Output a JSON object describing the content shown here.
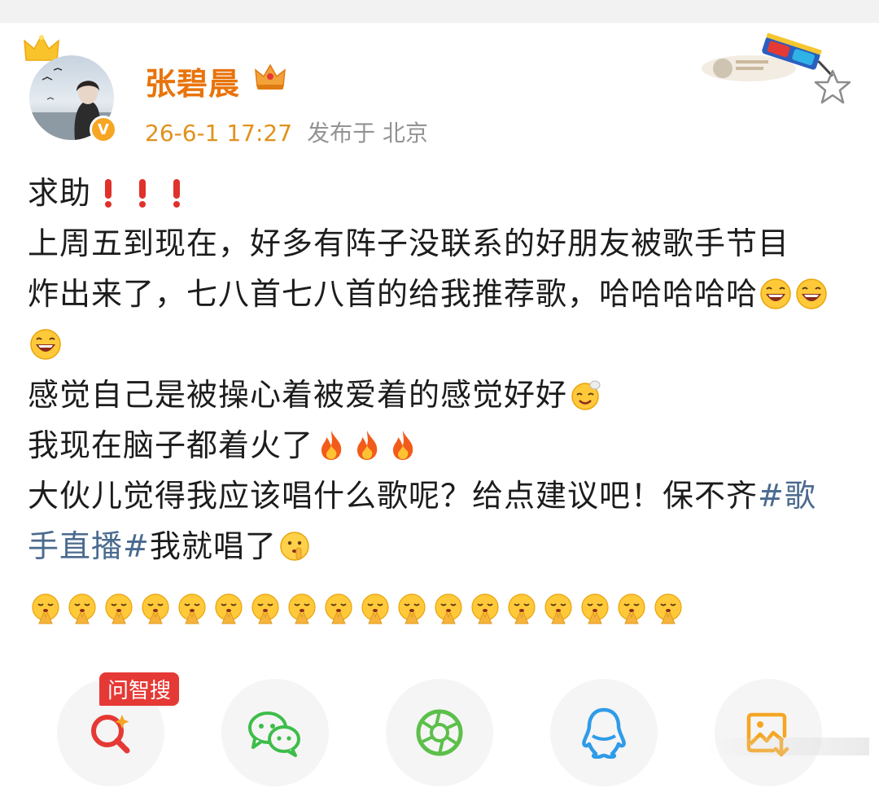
{
  "post": {
    "author": "张碧晨",
    "timestamp": "26-6-1 17:27",
    "location": "发布于 北京",
    "lines": {
      "l1": "求助",
      "l2": "上周五到现在，好多有阵子没联系的好朋友被歌手节目",
      "l3": "炸出来了，七八首七八首的给我推荐歌，哈哈哈哈哈",
      "l5": "感觉自己是被操心着被爱着的感觉好好",
      "l6": "我现在脑子都着火了",
      "l7a": "大伙儿觉得我应该唱什么歌呢？给点建议吧！保不齐",
      "l7tag": "#歌",
      "l8tag": "手直播#",
      "l8b": " 我就唱了"
    }
  },
  "share": {
    "ask_badge": "问智搜",
    "items": [
      "search-ai",
      "wechat",
      "moments",
      "qq",
      "save-image"
    ]
  },
  "colors": {
    "username": "#e8740c",
    "time": "#e0911c",
    "topic": "#4a6a8f",
    "badge": "#e53935"
  }
}
